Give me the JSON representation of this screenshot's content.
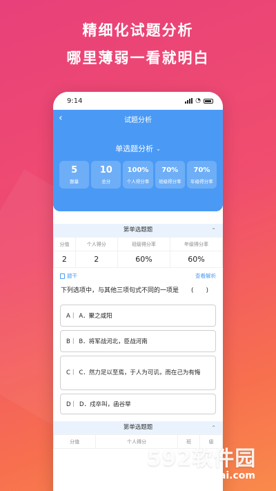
{
  "promo": {
    "line1": "精细化试题分析",
    "line2": "哪里薄弱一看就明白"
  },
  "status": {
    "time": "9:14"
  },
  "nav": {
    "title": "试题分析"
  },
  "selector": {
    "label": "单选题分析"
  },
  "stats": [
    {
      "value": "5",
      "label": "题量"
    },
    {
      "value": "10",
      "label": "总分"
    },
    {
      "value": "100%",
      "label": "个人得分率"
    },
    {
      "value": "70%",
      "label": "班级得分率"
    },
    {
      "value": "70%",
      "label": "年级得分率"
    }
  ],
  "section1": {
    "title": "第单选题题",
    "headers": [
      "分值",
      "个人得分",
      "班级得分率",
      "年级得分率"
    ],
    "values": [
      "2",
      "2",
      "60%",
      "60%"
    ]
  },
  "question_bar": {
    "stem_label": "题干",
    "analysis_link": "查看解析"
  },
  "question": {
    "text": "下列选项中，与其他三项句式不同的一项是　　(　　)"
  },
  "options": [
    {
      "letter": "A｜",
      "text": "A．聚之咸阳"
    },
    {
      "letter": "B｜",
      "text": "B．将军战河北，臣战河南"
    },
    {
      "letter": "C｜",
      "text": "C．然力足以至焉，于人为可讥，而在己为有悔"
    },
    {
      "letter": "D｜",
      "text": "D．戍卒叫，函谷举"
    }
  ],
  "section2": {
    "title": "第单选题题",
    "headers": [
      "分值",
      "个人得分",
      "班",
      "级"
    ]
  },
  "watermark": {
    "logo": "592软件园",
    "url": "www.592xiazai.com"
  },
  "colors": {
    "accent": "#4a9af5",
    "bg_start": "#e8407a",
    "bg_end": "#f98a4b"
  }
}
